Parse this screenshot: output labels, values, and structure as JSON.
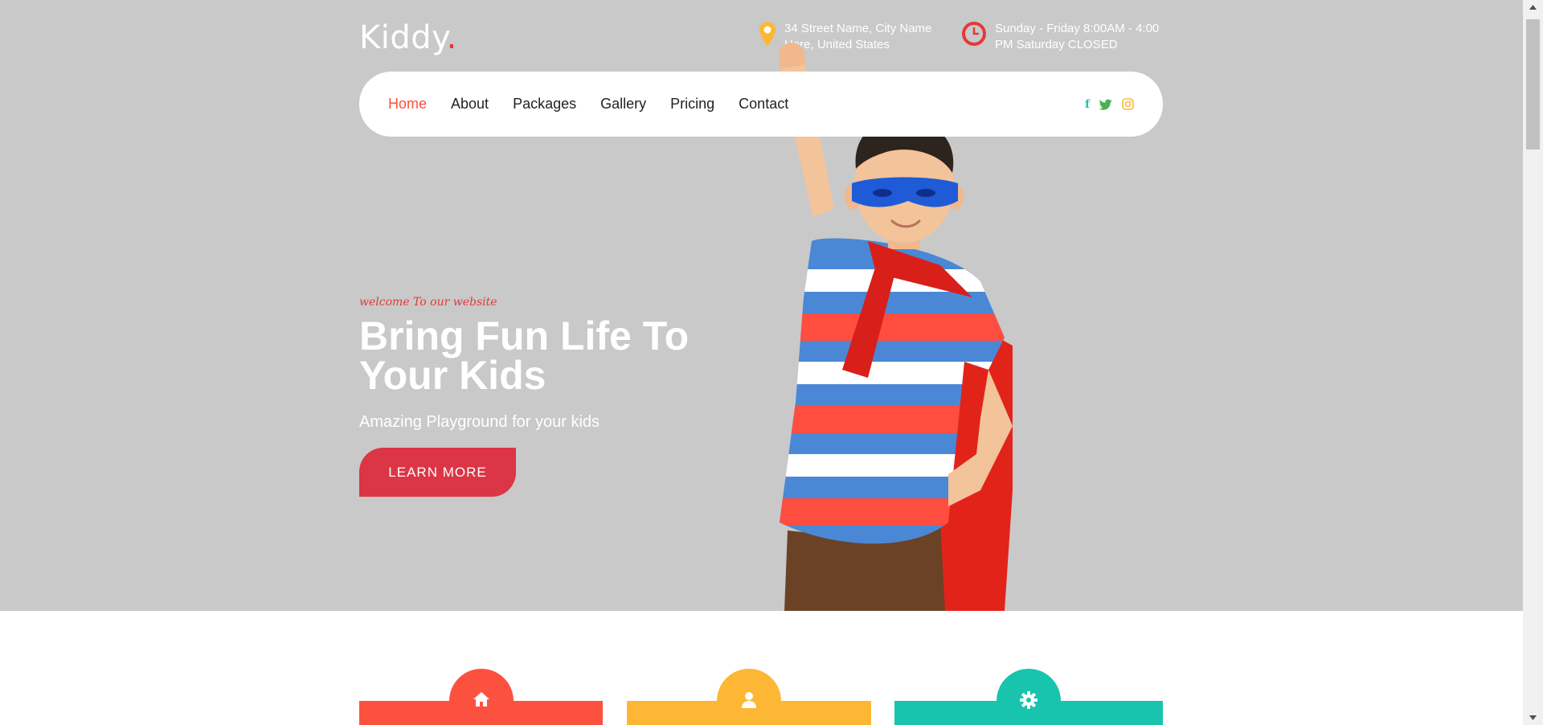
{
  "brand": {
    "name": "Kiddy",
    "dot": "."
  },
  "contact": {
    "address": "34 Street Name, City Name Here, United States",
    "hours": "Sunday - Friday 8:00AM - 4:00 PM Saturday CLOSED"
  },
  "nav": {
    "items": [
      {
        "label": "Home",
        "active": true
      },
      {
        "label": "About"
      },
      {
        "label": "Packages"
      },
      {
        "label": "Gallery"
      },
      {
        "label": "Pricing"
      },
      {
        "label": "Contact"
      }
    ],
    "socials": [
      {
        "icon": "facebook-icon",
        "glyph": "f",
        "color": "#18c4ae"
      },
      {
        "icon": "twitter-icon",
        "glyph": "t",
        "color": "#4caf50"
      },
      {
        "icon": "instagram-icon",
        "glyph": "◎",
        "color": "#fdb734"
      }
    ]
  },
  "hero": {
    "welcome": "welcome To our website",
    "headline": "Bring Fun Life To Your Kids",
    "subheadline": "Amazing Playground for your kids",
    "cta_label": "LEARN MORE"
  },
  "features": [
    {
      "icon": "home-icon",
      "color": "#fd5140"
    },
    {
      "icon": "user-icon",
      "color": "#fdb734"
    },
    {
      "icon": "gear-icon",
      "color": "#18c4ae"
    }
  ],
  "colors": {
    "hero_bg": "#c9c9c9",
    "accent_red": "#dc3545",
    "nav_active": "#ff4d3a",
    "location_icon": "#fdb734",
    "clock_icon": "#e5383b"
  }
}
